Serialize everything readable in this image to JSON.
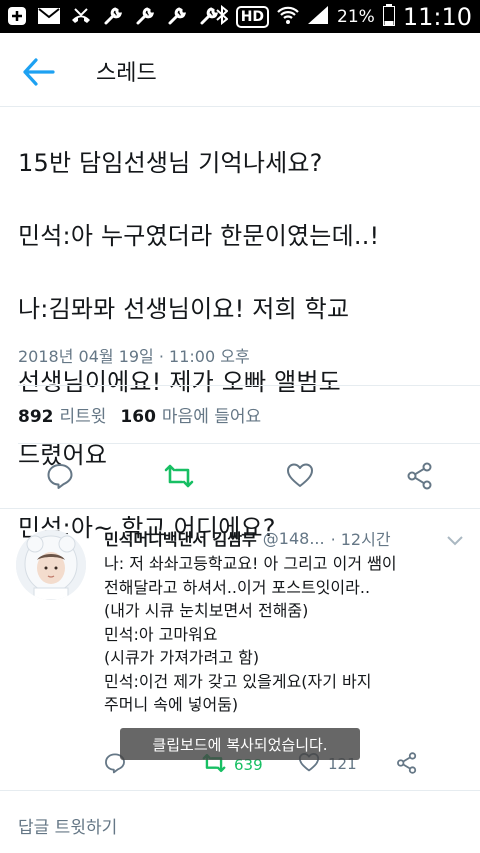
{
  "status_bar": {
    "hd": "HD",
    "battery": "21%",
    "time": "11:10"
  },
  "header": {
    "title": "스레드"
  },
  "tweet": {
    "lines": [
      "15반 담임선생님 기억나세요?",
      "민석:아 누구였더라 한문이였는데..!",
      "나:김뫄뫄 선생님이요! 저희 학교",
      "선생님이에요! 제가 오빠 앨범도",
      "드렸어요",
      "민석:아~ 학교 어디에요?"
    ],
    "timestamp": "2018년 04월 19일 · 11:00 오후",
    "retweets_count": "892",
    "retweets_label": "리트윗",
    "likes_count": "160",
    "likes_label": "마음에 들어요"
  },
  "reply": {
    "name": "민석머니백댄서 김쌈무",
    "handle": "@148...",
    "time": "· 12시간",
    "lines": [
      "나: 저 솨솨고등학교요! 아 그리고 이거 쌤이",
      "전해달라고 하셔서..이거 포스트잇이라..",
      "(내가 시큐 눈치보면서 전해줌)",
      "민석:아 고마워요",
      "(시큐가 가져가려고 함)",
      "민석:이건 제가 갖고 있을게요(자기 바지",
      "주머니 속에 넣어둠)"
    ],
    "retweet_count": "639",
    "like_count": "121"
  },
  "toast": "클립보드에 복사되었습니다.",
  "reply_bar": {
    "placeholder": "답글 트윗하기"
  },
  "colors": {
    "accent": "#1da1f2",
    "retweet_green": "#17bf63",
    "muted": "#657786"
  }
}
